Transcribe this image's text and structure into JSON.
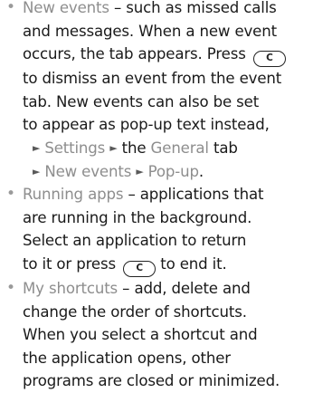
{
  "items": [
    {
      "term": "New events",
      "lines": [
        " – such as missed calls",
        "and messages. When a new event",
        "occurs, the tab appears. Press ",
        "to dismiss an event from the event",
        "tab. New events can also be set",
        "to appear as pop-up text instead,"
      ],
      "key": "C",
      "path1": [
        "Settings",
        "the ",
        "General",
        " tab"
      ],
      "path2": [
        "New events",
        "Pop-up",
        "."
      ]
    },
    {
      "term": "Running apps",
      "lines": [
        " – applications that",
        "are running in the background.",
        "Select an application to return",
        "to it or press ",
        " to end it."
      ],
      "key": "C"
    },
    {
      "term": "My shortcuts",
      "lines": [
        " – add, delete and",
        "change the order of shortcuts.",
        "When you select a shortcut and",
        "the application opens, other",
        "programs are closed or minimized."
      ]
    }
  ],
  "arrow_glyph": "►",
  "bullet_glyph": "•"
}
